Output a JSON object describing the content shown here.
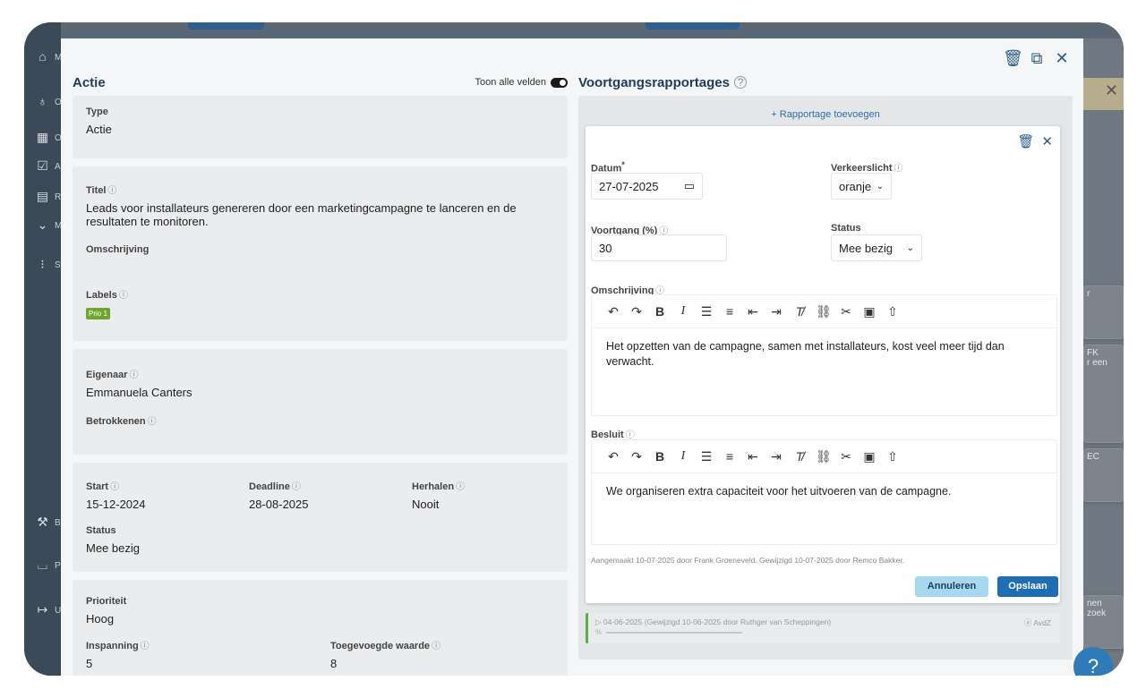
{
  "background_app": {
    "sidebar_labels": [
      "M",
      "O",
      "O",
      "A",
      "R",
      "M",
      "S",
      "B",
      "P",
      "U"
    ],
    "right_cards": [
      "r",
      "FK",
      "r een",
      "EC",
      "nen",
      "zoek"
    ]
  },
  "modal": {
    "icons": [
      "trash-icon",
      "window-icon",
      "close-icon"
    ]
  },
  "actie": {
    "title": "Actie",
    "toggle_label": "Toon alle velden",
    "type_label": "Type",
    "type_value": "Actie",
    "titel_label": "Titel",
    "titel_value": "Leads voor installateurs genereren door een marketingcampagne te lanceren en de resultaten te monitoren.",
    "omschrijving_label": "Omschrijving",
    "labels_label": "Labels",
    "label_tag": "Prio 1",
    "eigenaar_label": "Eigenaar",
    "eigenaar_value": "Emmanuela Canters",
    "betrokkenen_label": "Betrokkenen",
    "start_label": "Start",
    "start_value": "15-12-2024",
    "deadline_label": "Deadline",
    "deadline_value": "28-08-2025",
    "herhalen_label": "Herhalen",
    "herhalen_value": "Nooit",
    "status_label": "Status",
    "status_value": "Mee bezig",
    "prioriteit_label": "Prioriteit",
    "prioriteit_value": "Hoog",
    "inspanning_label": "Inspanning",
    "inspanning_value": "5",
    "toegevoegde_label": "Toegevoegde waarde",
    "toegevoegde_value": "8"
  },
  "voortgang": {
    "title": "Voortgangsrapportages",
    "add_link": "+ Rapportage toevoegen",
    "form": {
      "datum_label": "Datum",
      "datum_required": "*",
      "datum_value": "27-07-2025",
      "verkeerslicht_label": "Verkeerslicht",
      "verkeerslicht_value": "oranje",
      "voortgang_label": "Voortgang (%)",
      "voortgang_value": "30",
      "status_label": "Status",
      "status_value": "Mee bezig",
      "omschrijving_label": "Omschrijving",
      "omschrijving_text": "Het opzetten van de campagne, samen met installateurs, kost veel meer tijd dan verwacht.",
      "besluit_label": "Besluit",
      "besluit_text": "We organiseren extra capaciteit voor het uitvoeren van de campagne.",
      "meta_text": "Aangemaakt 10-07-2025 door Frank Groeneveld. Gewijzigd 10-07-2025 door Remco Bakker.",
      "cancel_label": "Annuleren",
      "save_label": "Opslaan"
    },
    "previous_report": {
      "text": "▷ 04-06-2025 (Gewijzigd 10-06-2025 door Ruthger van Scheppingen)",
      "initials": "AvdZ",
      "pct_symbol": "%"
    }
  },
  "help_label": "?"
}
